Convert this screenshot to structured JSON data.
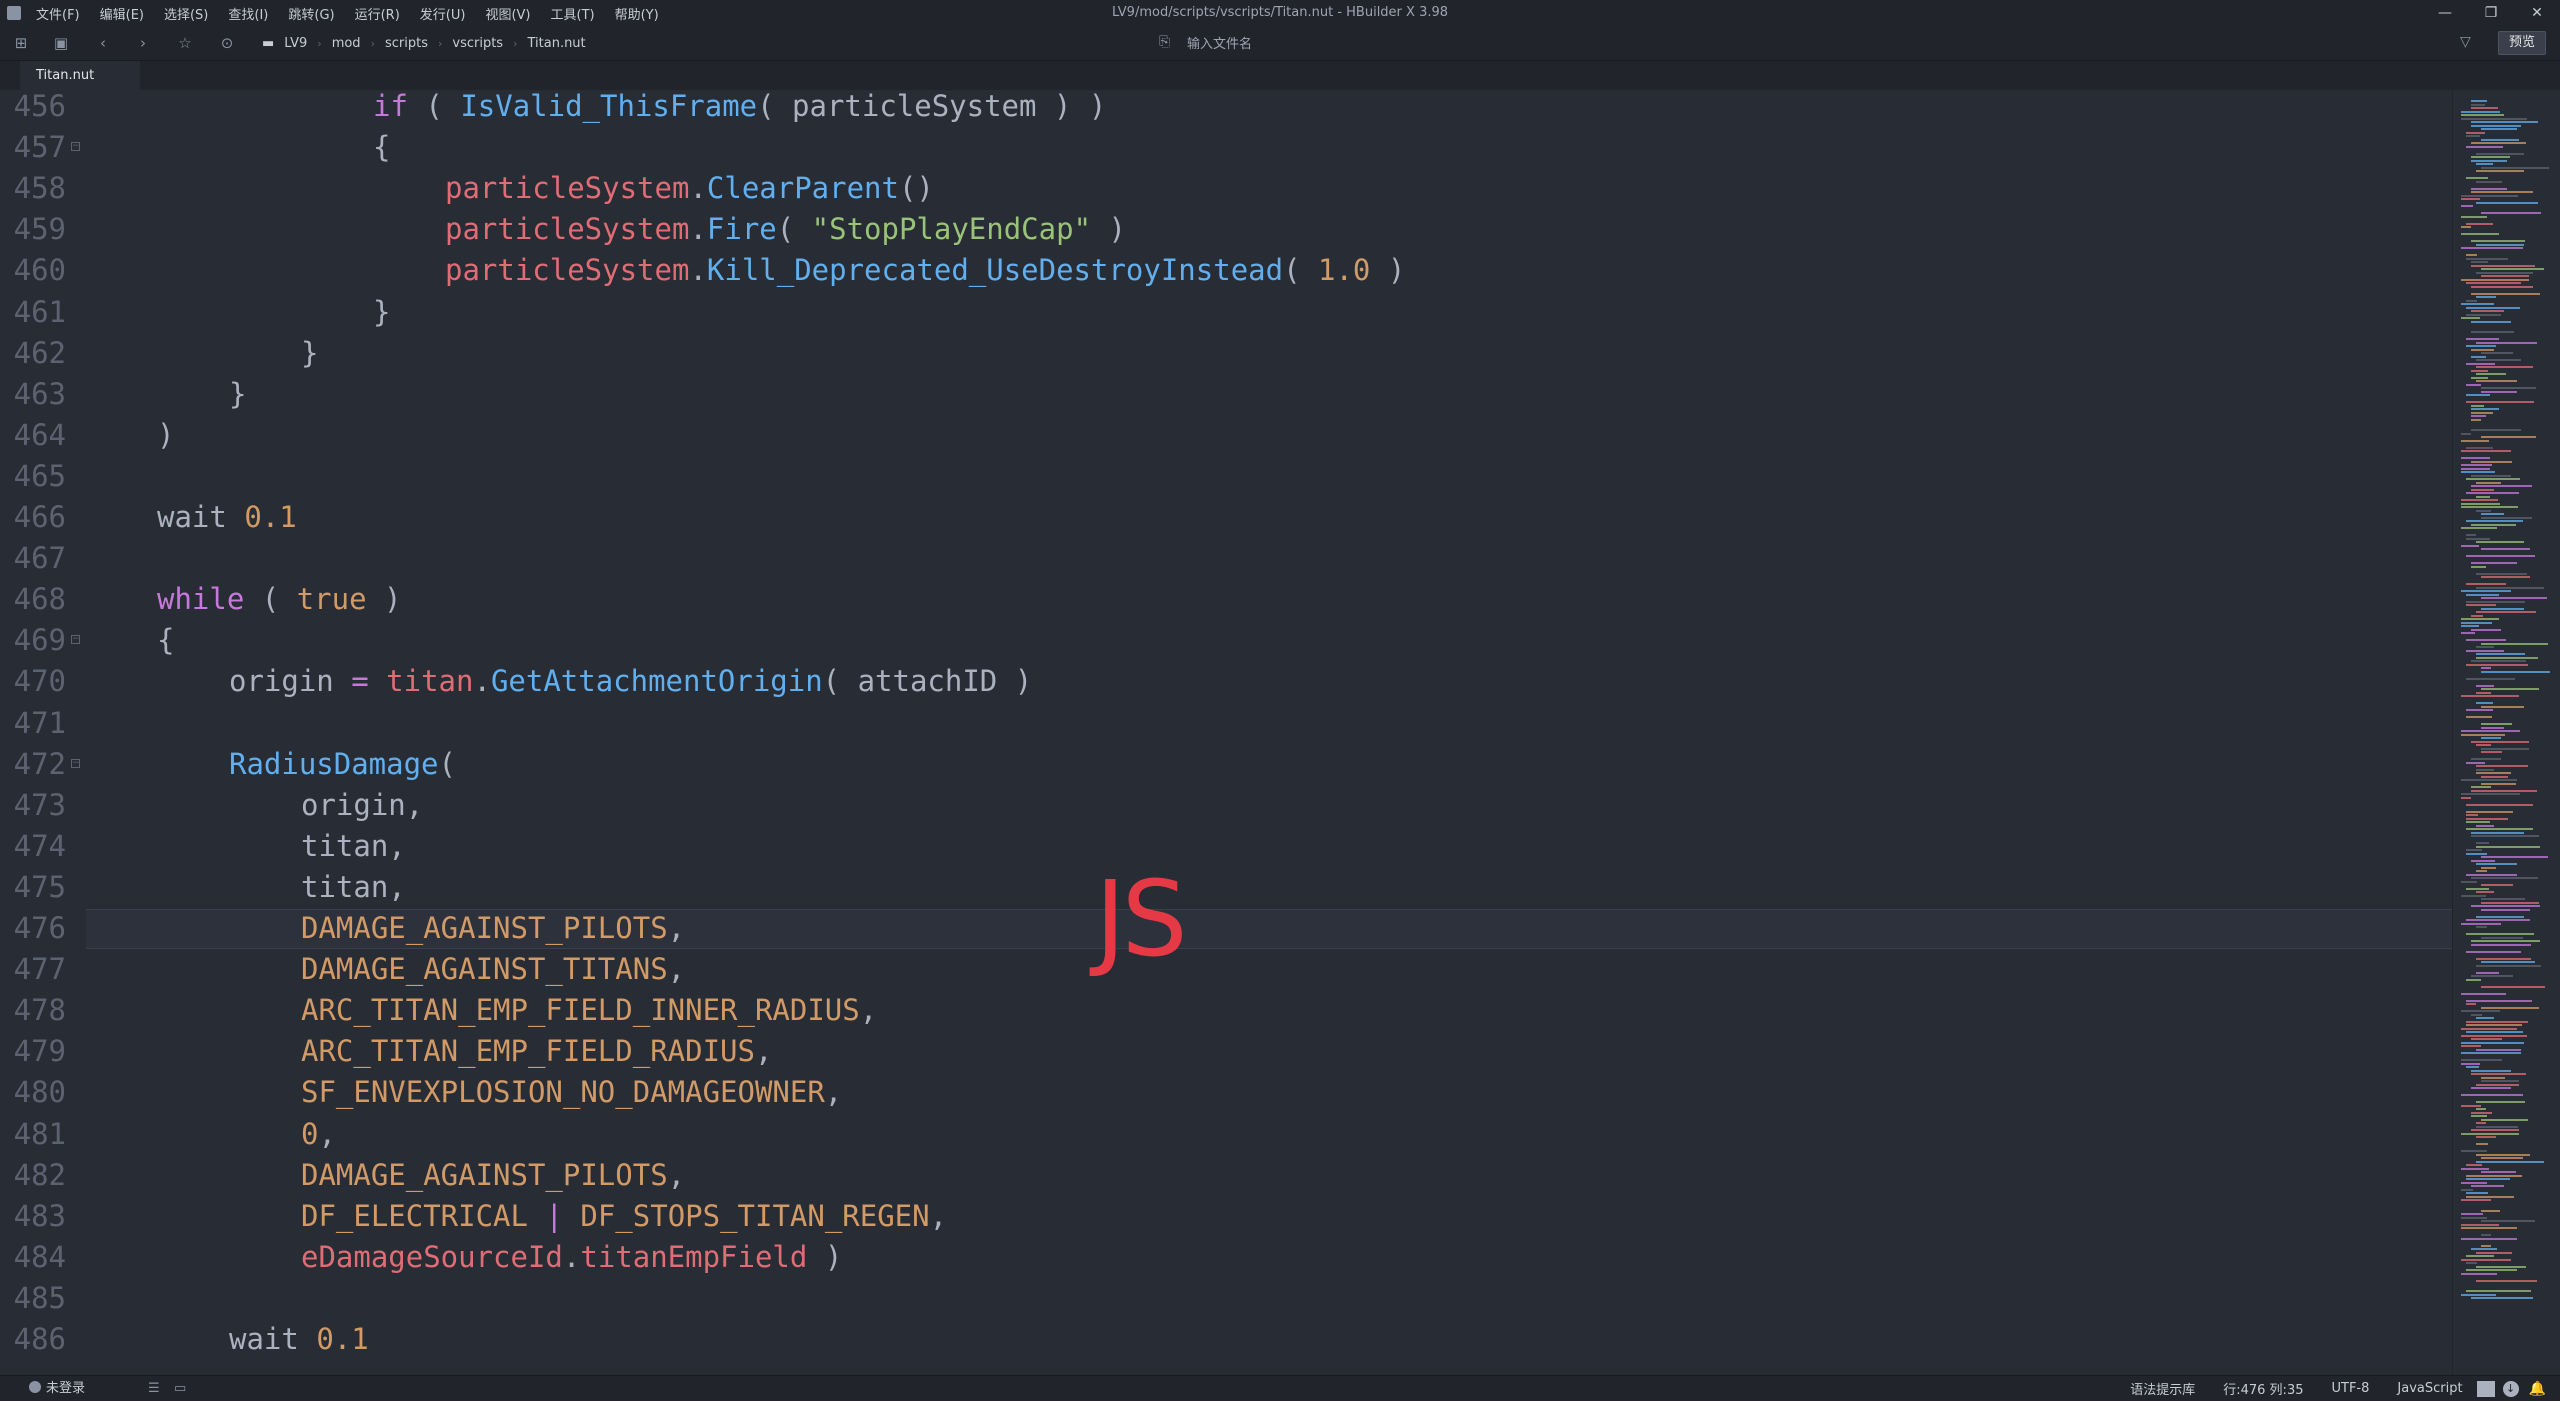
{
  "window": {
    "title": "LV9/mod/scripts/vscripts/Titan.nut - HBuilder X 3.98",
    "controls": [
      "—",
      "❐",
      "✕"
    ]
  },
  "menu": [
    "文件(F)",
    "编辑(E)",
    "选择(S)",
    "查找(I)",
    "跳转(G)",
    "运行(R)",
    "发行(U)",
    "视图(V)",
    "工具(T)",
    "帮助(Y)"
  ],
  "breadcrumb": [
    "LV9",
    "mod",
    "scripts",
    "vscripts",
    "Titan.nut"
  ],
  "toolbar": {
    "file_input_placeholder": "输入文件名",
    "preview_label": "预览"
  },
  "tabs": [
    {
      "label": "Titan.nut"
    }
  ],
  "editor": {
    "language_colors": {
      "keyword": "#c678dd",
      "function": "#61afef",
      "string": "#98c379",
      "number": "#d19a66",
      "variable": "#e06c75"
    },
    "current_line": 476,
    "lines": [
      {
        "n": "456",
        "fold": false,
        "indent": 6,
        "tokens": [
          [
            "keyword",
            "if"
          ],
          [
            "plain",
            " ( "
          ],
          [
            "function",
            "IsValid_ThisFrame"
          ],
          [
            "plain",
            "( particleSystem ) )"
          ]
        ]
      },
      {
        "n": "457",
        "fold": true,
        "indent": 6,
        "tokens": [
          [
            "plain",
            "{"
          ]
        ]
      },
      {
        "n": "458",
        "fold": false,
        "indent": 8,
        "tokens": [
          [
            "variable",
            "particleSystem"
          ],
          [
            "plain",
            "."
          ],
          [
            "function",
            "ClearParent"
          ],
          [
            "plain",
            "()"
          ]
        ]
      },
      {
        "n": "459",
        "fold": false,
        "indent": 8,
        "tokens": [
          [
            "variable",
            "particleSystem"
          ],
          [
            "plain",
            "."
          ],
          [
            "function",
            "Fire"
          ],
          [
            "plain",
            "( "
          ],
          [
            "string",
            "\"StopPlayEndCap\""
          ],
          [
            "plain",
            " )"
          ]
        ]
      },
      {
        "n": "460",
        "fold": false,
        "indent": 8,
        "tokens": [
          [
            "variable",
            "particleSystem"
          ],
          [
            "plain",
            "."
          ],
          [
            "function",
            "Kill_Deprecated_UseDestroyInstead"
          ],
          [
            "plain",
            "( "
          ],
          [
            "number",
            "1.0"
          ],
          [
            "plain",
            " )"
          ]
        ]
      },
      {
        "n": "461",
        "fold": false,
        "indent": 6,
        "tokens": [
          [
            "plain",
            "}"
          ]
        ]
      },
      {
        "n": "462",
        "fold": false,
        "indent": 4,
        "tokens": [
          [
            "plain",
            "}"
          ]
        ]
      },
      {
        "n": "463",
        "fold": false,
        "indent": 2,
        "tokens": [
          [
            "plain",
            "}"
          ]
        ]
      },
      {
        "n": "464",
        "fold": false,
        "indent": 0,
        "tokens": [
          [
            "plain",
            ")"
          ]
        ]
      },
      {
        "n": "465",
        "fold": false,
        "indent": 0,
        "tokens": []
      },
      {
        "n": "466",
        "fold": false,
        "indent": 0,
        "tokens": [
          [
            "plain",
            "wait "
          ],
          [
            "number",
            "0.1"
          ]
        ]
      },
      {
        "n": "467",
        "fold": false,
        "indent": 0,
        "tokens": []
      },
      {
        "n": "468",
        "fold": false,
        "indent": 0,
        "tokens": [
          [
            "keyword",
            "while"
          ],
          [
            "plain",
            " ( "
          ],
          [
            "constant",
            "true"
          ],
          [
            "plain",
            " )"
          ]
        ]
      },
      {
        "n": "469",
        "fold": true,
        "indent": 0,
        "tokens": [
          [
            "plain",
            "{"
          ]
        ]
      },
      {
        "n": "470",
        "fold": false,
        "indent": 2,
        "tokens": [
          [
            "plain",
            "origin "
          ],
          [
            "operator",
            "="
          ],
          [
            "plain",
            " "
          ],
          [
            "variable",
            "titan"
          ],
          [
            "plain",
            "."
          ],
          [
            "function",
            "GetAttachmentOrigin"
          ],
          [
            "plain",
            "( attachID )"
          ]
        ]
      },
      {
        "n": "471",
        "fold": false,
        "indent": 0,
        "tokens": []
      },
      {
        "n": "472",
        "fold": true,
        "indent": 2,
        "tokens": [
          [
            "function",
            "RadiusDamage"
          ],
          [
            "plain",
            "("
          ]
        ]
      },
      {
        "n": "473",
        "fold": false,
        "indent": 4,
        "tokens": [
          [
            "plain",
            "origin,"
          ]
        ]
      },
      {
        "n": "474",
        "fold": false,
        "indent": 4,
        "tokens": [
          [
            "plain",
            "titan,"
          ]
        ]
      },
      {
        "n": "475",
        "fold": false,
        "indent": 4,
        "tokens": [
          [
            "plain",
            "titan,"
          ]
        ]
      },
      {
        "n": "476",
        "fold": false,
        "indent": 4,
        "tokens": [
          [
            "constant",
            "DAMAGE_AGAINST_PILOTS"
          ],
          [
            "plain",
            ","
          ]
        ]
      },
      {
        "n": "477",
        "fold": false,
        "indent": 4,
        "tokens": [
          [
            "constant",
            "DAMAGE_AGAINST_TITANS"
          ],
          [
            "plain",
            ","
          ]
        ]
      },
      {
        "n": "478",
        "fold": false,
        "indent": 4,
        "tokens": [
          [
            "constant",
            "ARC_TITAN_EMP_FIELD_INNER_RADIUS"
          ],
          [
            "plain",
            ","
          ]
        ]
      },
      {
        "n": "479",
        "fold": false,
        "indent": 4,
        "tokens": [
          [
            "constant",
            "ARC_TITAN_EMP_FIELD_RADIUS"
          ],
          [
            "plain",
            ","
          ]
        ]
      },
      {
        "n": "480",
        "fold": false,
        "indent": 4,
        "tokens": [
          [
            "constant",
            "SF_ENVEXPLOSION_NO_DAMAGEOWNER"
          ],
          [
            "plain",
            ","
          ]
        ]
      },
      {
        "n": "481",
        "fold": false,
        "indent": 4,
        "tokens": [
          [
            "number",
            "0"
          ],
          [
            "plain",
            ","
          ]
        ]
      },
      {
        "n": "482",
        "fold": false,
        "indent": 4,
        "tokens": [
          [
            "constant",
            "DAMAGE_AGAINST_PILOTS"
          ],
          [
            "plain",
            ","
          ]
        ]
      },
      {
        "n": "483",
        "fold": false,
        "indent": 4,
        "tokens": [
          [
            "constant",
            "DF_ELECTRICAL"
          ],
          [
            "plain",
            " "
          ],
          [
            "operator",
            "|"
          ],
          [
            "plain",
            " "
          ],
          [
            "constant",
            "DF_STOPS_TITAN_REGEN"
          ],
          [
            "plain",
            ","
          ]
        ]
      },
      {
        "n": "484",
        "fold": false,
        "indent": 4,
        "tokens": [
          [
            "variable",
            "eDamageSourceId"
          ],
          [
            "plain",
            "."
          ],
          [
            "variable",
            "titanEmpField"
          ],
          [
            "plain",
            " )"
          ]
        ]
      },
      {
        "n": "485",
        "fold": false,
        "indent": 0,
        "tokens": []
      },
      {
        "n": "486",
        "fold": false,
        "indent": 2,
        "tokens": [
          [
            "plain",
            "wait "
          ],
          [
            "number",
            "0.1"
          ]
        ]
      }
    ]
  },
  "watermark": "JS",
  "statusbar": {
    "login": "未登录",
    "hint": "语法提示库",
    "position": "行:476  列:35",
    "encoding": "UTF-8",
    "language": "JavaScript"
  }
}
